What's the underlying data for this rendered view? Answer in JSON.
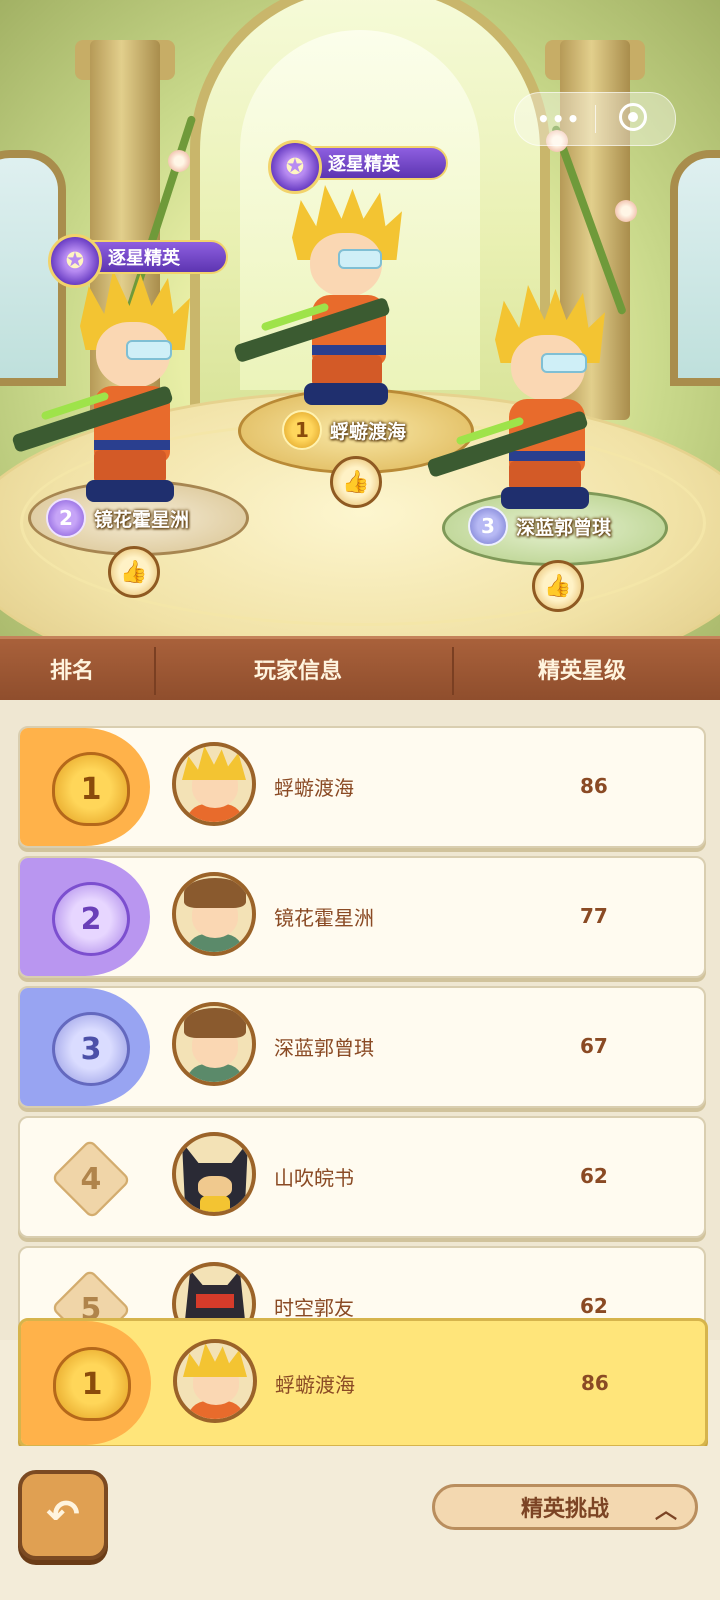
{
  "mini_program": {
    "more_icon": "more-dots-icon",
    "close_icon": "target-circle-icon",
    "more_glyph": "•••"
  },
  "podium": {
    "title_badge": "逐星精英",
    "players": [
      {
        "rank": "1",
        "name": "蜉蝣渡海",
        "show_title": true
      },
      {
        "rank": "2",
        "name": "镜花霍星洲",
        "show_title": true
      },
      {
        "rank": "3",
        "name": "深蓝郭曾琪",
        "show_title": false
      }
    ],
    "like_icon": "thumbs-up-icon"
  },
  "table_header": {
    "rank": "排名",
    "player_info": "玩家信息",
    "elite_stars": "精英星级"
  },
  "rows": [
    {
      "rank": "1",
      "name": "蜉蝣渡海",
      "score": "86"
    },
    {
      "rank": "2",
      "name": "镜花霍星洲",
      "score": "77"
    },
    {
      "rank": "3",
      "name": "深蓝郭曾琪",
      "score": "67"
    },
    {
      "rank": "4",
      "name": "山吹皖书",
      "score": "62"
    },
    {
      "rank": "5",
      "name": "时空郭友",
      "score": "62"
    }
  ],
  "my_rank": {
    "rank": "1",
    "name": "蜉蝣渡海",
    "score": "86"
  },
  "footer": {
    "back_icon": "back-arrow-icon",
    "challenge_label": "精英挑战",
    "chevron_icon": "chevron-up-icon"
  },
  "colors": {
    "header_brown": "#9a5633",
    "gold": "#ffd659",
    "purple": "#a37ce6",
    "blue": "#8d92e0",
    "my_row": "#ffe57a"
  }
}
